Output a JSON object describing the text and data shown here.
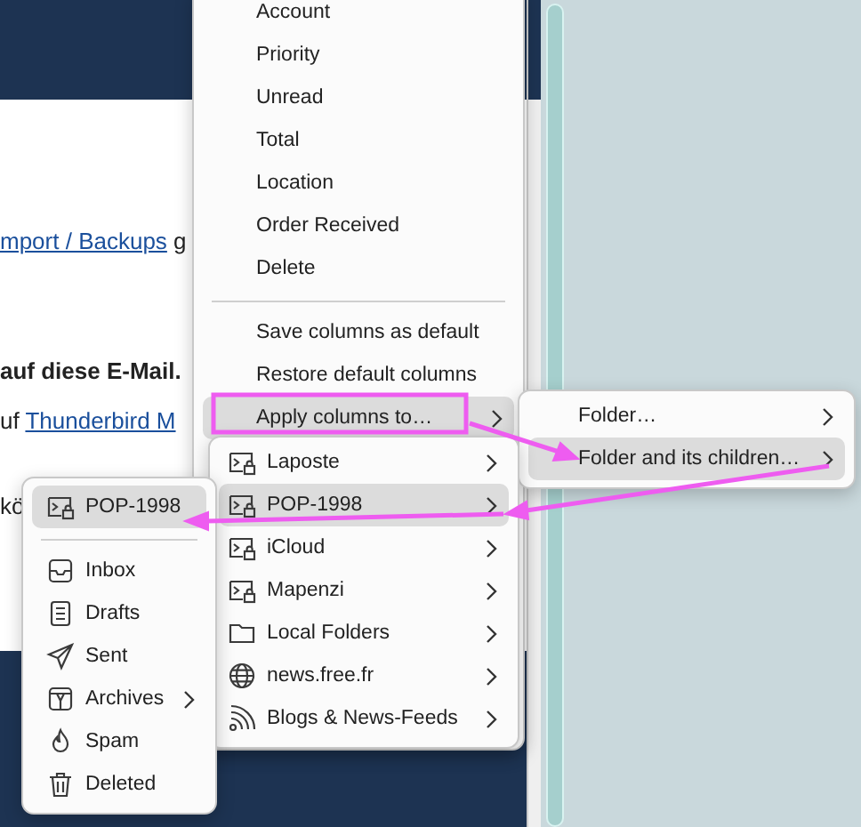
{
  "background": {
    "lines": [
      {
        "kind": "plain",
        "segments": [
          {
            "text": "mport / Backups",
            "link": true
          },
          {
            "text": " g",
            "link": false
          }
        ]
      },
      {
        "kind": "bold",
        "segments": [
          {
            "text": "auf diese E-Mail.",
            "link": false
          }
        ]
      },
      {
        "kind": "plain",
        "segments": [
          {
            "text": "uf ",
            "link": false
          },
          {
            "text": "Thunderbird M",
            "link": true
          }
        ]
      },
      {
        "kind": "plain",
        "segments": [
          {
            "text": "kö",
            "link": false
          }
        ]
      }
    ]
  },
  "menus": [
    {
      "items": [
        {
          "kind": "text",
          "label": "Account",
          "selected": false,
          "submenu": false
        },
        {
          "kind": "text",
          "label": "Priority",
          "selected": false,
          "submenu": false
        },
        {
          "kind": "text",
          "label": "Unread",
          "selected": false,
          "submenu": false
        },
        {
          "kind": "text",
          "label": "Total",
          "selected": false,
          "submenu": false
        },
        {
          "kind": "text",
          "label": "Location",
          "selected": false,
          "submenu": false
        },
        {
          "kind": "text",
          "label": "Order Received",
          "selected": false,
          "submenu": false
        },
        {
          "kind": "text",
          "label": "Delete",
          "selected": false,
          "submenu": false
        },
        {
          "kind": "separator"
        },
        {
          "kind": "text",
          "label": "Save columns as default",
          "selected": false,
          "submenu": false
        },
        {
          "kind": "text",
          "label": "Restore default columns",
          "selected": false,
          "submenu": false
        },
        {
          "kind": "text",
          "label": "Apply columns to…",
          "selected": true,
          "submenu": true
        }
      ]
    },
    {
      "items": [
        {
          "kind": "text",
          "label": "Folder…",
          "selected": false,
          "submenu": true
        },
        {
          "kind": "text",
          "label": "Folder and its children…",
          "selected": true,
          "submenu": true
        }
      ]
    },
    {
      "items": [
        {
          "kind": "mail-account",
          "label": "Laposte",
          "selected": false,
          "submenu": true
        },
        {
          "kind": "mail-account",
          "label": "POP-1998",
          "selected": true,
          "submenu": true
        },
        {
          "kind": "mail-account",
          "label": "iCloud",
          "selected": false,
          "submenu": true
        },
        {
          "kind": "mail-account",
          "label": "Mapenzi",
          "selected": false,
          "submenu": true
        },
        {
          "kind": "folder",
          "label": "Local Folders",
          "selected": false,
          "submenu": true
        },
        {
          "kind": "globe",
          "label": "news.free.fr",
          "selected": false,
          "submenu": true
        },
        {
          "kind": "feed",
          "label": "Blogs & News-Feeds",
          "selected": false,
          "submenu": true
        }
      ]
    },
    {
      "items": [
        {
          "kind": "mail-account",
          "label": "POP-1998",
          "selected": true,
          "submenu": false
        },
        {
          "kind": "separator"
        },
        {
          "kind": "inbox",
          "label": "Inbox",
          "selected": false,
          "submenu": false
        },
        {
          "kind": "drafts",
          "label": "Drafts",
          "selected": false,
          "submenu": false
        },
        {
          "kind": "sent",
          "label": "Sent",
          "selected": false,
          "submenu": false
        },
        {
          "kind": "archive",
          "label": "Archives",
          "selected": false,
          "submenu": true
        },
        {
          "kind": "spam",
          "label": "Spam",
          "selected": false,
          "submenu": false
        },
        {
          "kind": "trash",
          "label": "Deleted",
          "selected": false,
          "submenu": false
        }
      ]
    }
  ]
}
